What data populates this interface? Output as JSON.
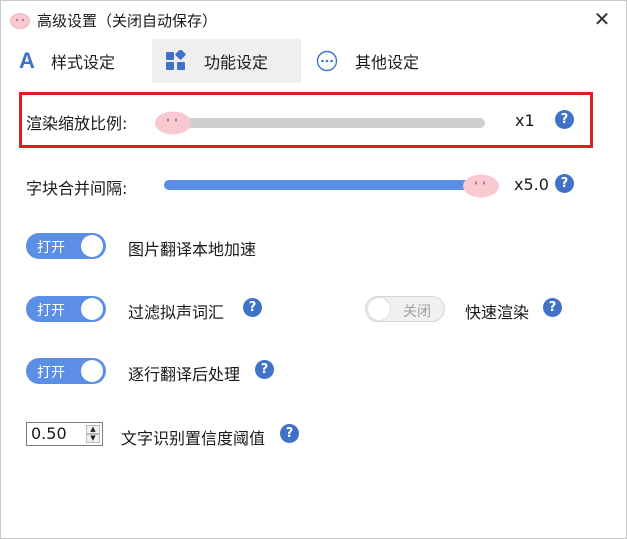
{
  "window": {
    "title": "高级设置（关闭自动保存）",
    "close_glyph": "✕"
  },
  "tabs": [
    {
      "label": "样式设定",
      "icon": "font-a-icon",
      "glyph": "A",
      "active": false
    },
    {
      "label": "功能设定",
      "icon": "widgets-icon",
      "active": true
    },
    {
      "label": "其他设定",
      "icon": "more-dots-icon",
      "glyph": "⋯",
      "active": false
    }
  ],
  "render_scale": {
    "label": "渲染缩放比例:",
    "value_text": "x1",
    "level": 0.0
  },
  "block_merge": {
    "label": "字块合并间隔:",
    "value_text": "x5.0",
    "level": 1.0
  },
  "local_accel": {
    "toggle_text": "打开",
    "state": "on",
    "label": "图片翻译本地加速"
  },
  "onomatopoeia": {
    "toggle_text": "打开",
    "state": "on",
    "label": "过滤拟声词汇"
  },
  "fast_render": {
    "toggle_text": "关闭",
    "state": "off",
    "label": "快速渲染"
  },
  "line_post": {
    "toggle_text": "打开",
    "state": "on",
    "label": "逐行翻译后处理"
  },
  "ocr_threshold": {
    "value": "0.50",
    "label": "文字识别置信度阈值"
  },
  "help_glyph": "?",
  "colors": {
    "accent": "#5b8fe6",
    "help": "#3f72c8",
    "highlight": "#e02020",
    "knob": "#f9c9d2"
  }
}
